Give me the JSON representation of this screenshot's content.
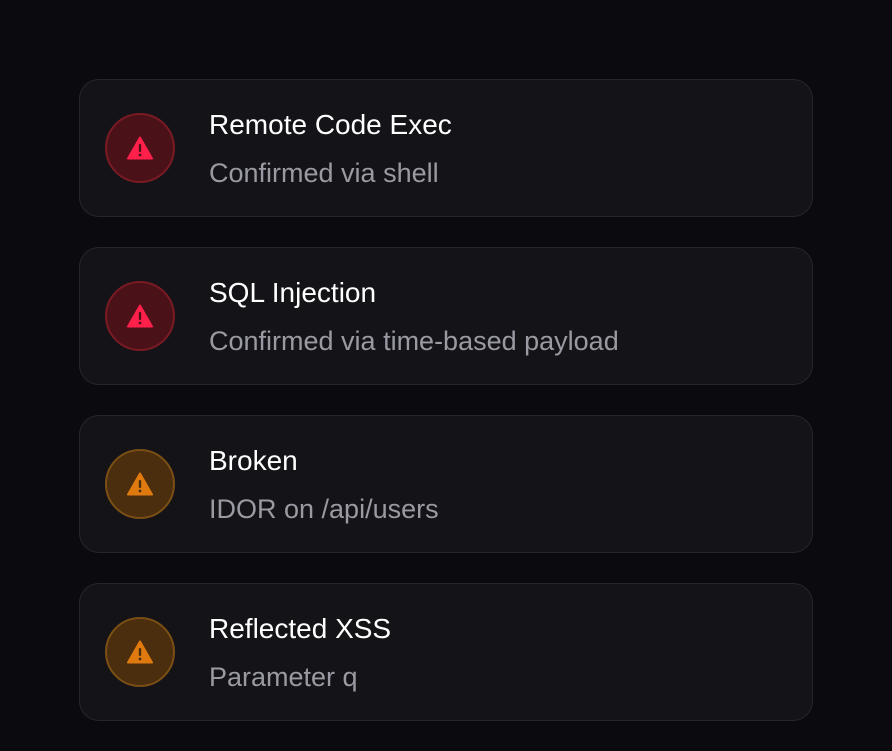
{
  "findings": [
    {
      "title": "Remote Code Exec",
      "detail": "Confirmed via shell",
      "severity": "critical",
      "icon": "warning-triangle-icon"
    },
    {
      "title": "SQL Injection",
      "detail": "Confirmed via time-based payload",
      "severity": "critical",
      "icon": "warning-triangle-icon"
    },
    {
      "title": "Broken",
      "detail": "IDOR on /api/users",
      "severity": "high",
      "icon": "warning-triangle-icon"
    },
    {
      "title": "Reflected XSS",
      "detail": "Parameter q",
      "severity": "high",
      "icon": "warning-triangle-icon"
    }
  ],
  "colors": {
    "background": "#0a0a0f",
    "card": "#131318",
    "critical_icon": "#ff1f4b",
    "high_icon": "#e07a10",
    "detail_text": "#9a9aa2"
  }
}
